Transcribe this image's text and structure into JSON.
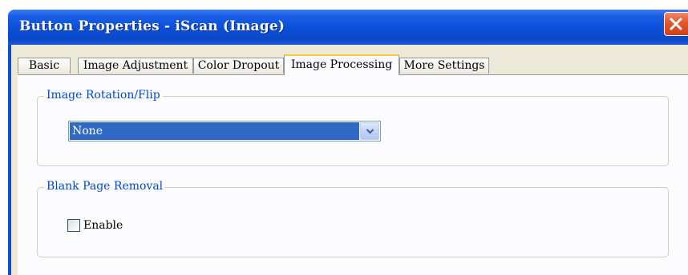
{
  "window": {
    "title": "Button Properties - iScan (Image)"
  },
  "tabs": [
    {
      "label": "Basic",
      "active": false
    },
    {
      "label": "Image Adjustment",
      "active": false
    },
    {
      "label": "Color Dropout",
      "active": false
    },
    {
      "label": "Image Processing",
      "active": true
    },
    {
      "label": "More Settings",
      "active": false
    }
  ],
  "rotation_group": {
    "label": "Image Rotation/Flip",
    "select_value": "None"
  },
  "blank_page_group": {
    "label": "Blank Page Removal",
    "enable_label": "Enable",
    "enable_checked": false
  },
  "colors": {
    "titlebar": "#0a4fd8",
    "selection": "#316ac5",
    "group_label": "#0046d5",
    "active_tab_accent": "#ffc83c",
    "close_button": "#e25a32"
  },
  "icons": {
    "close": "close-icon",
    "dropdown": "chevron-down-icon"
  }
}
